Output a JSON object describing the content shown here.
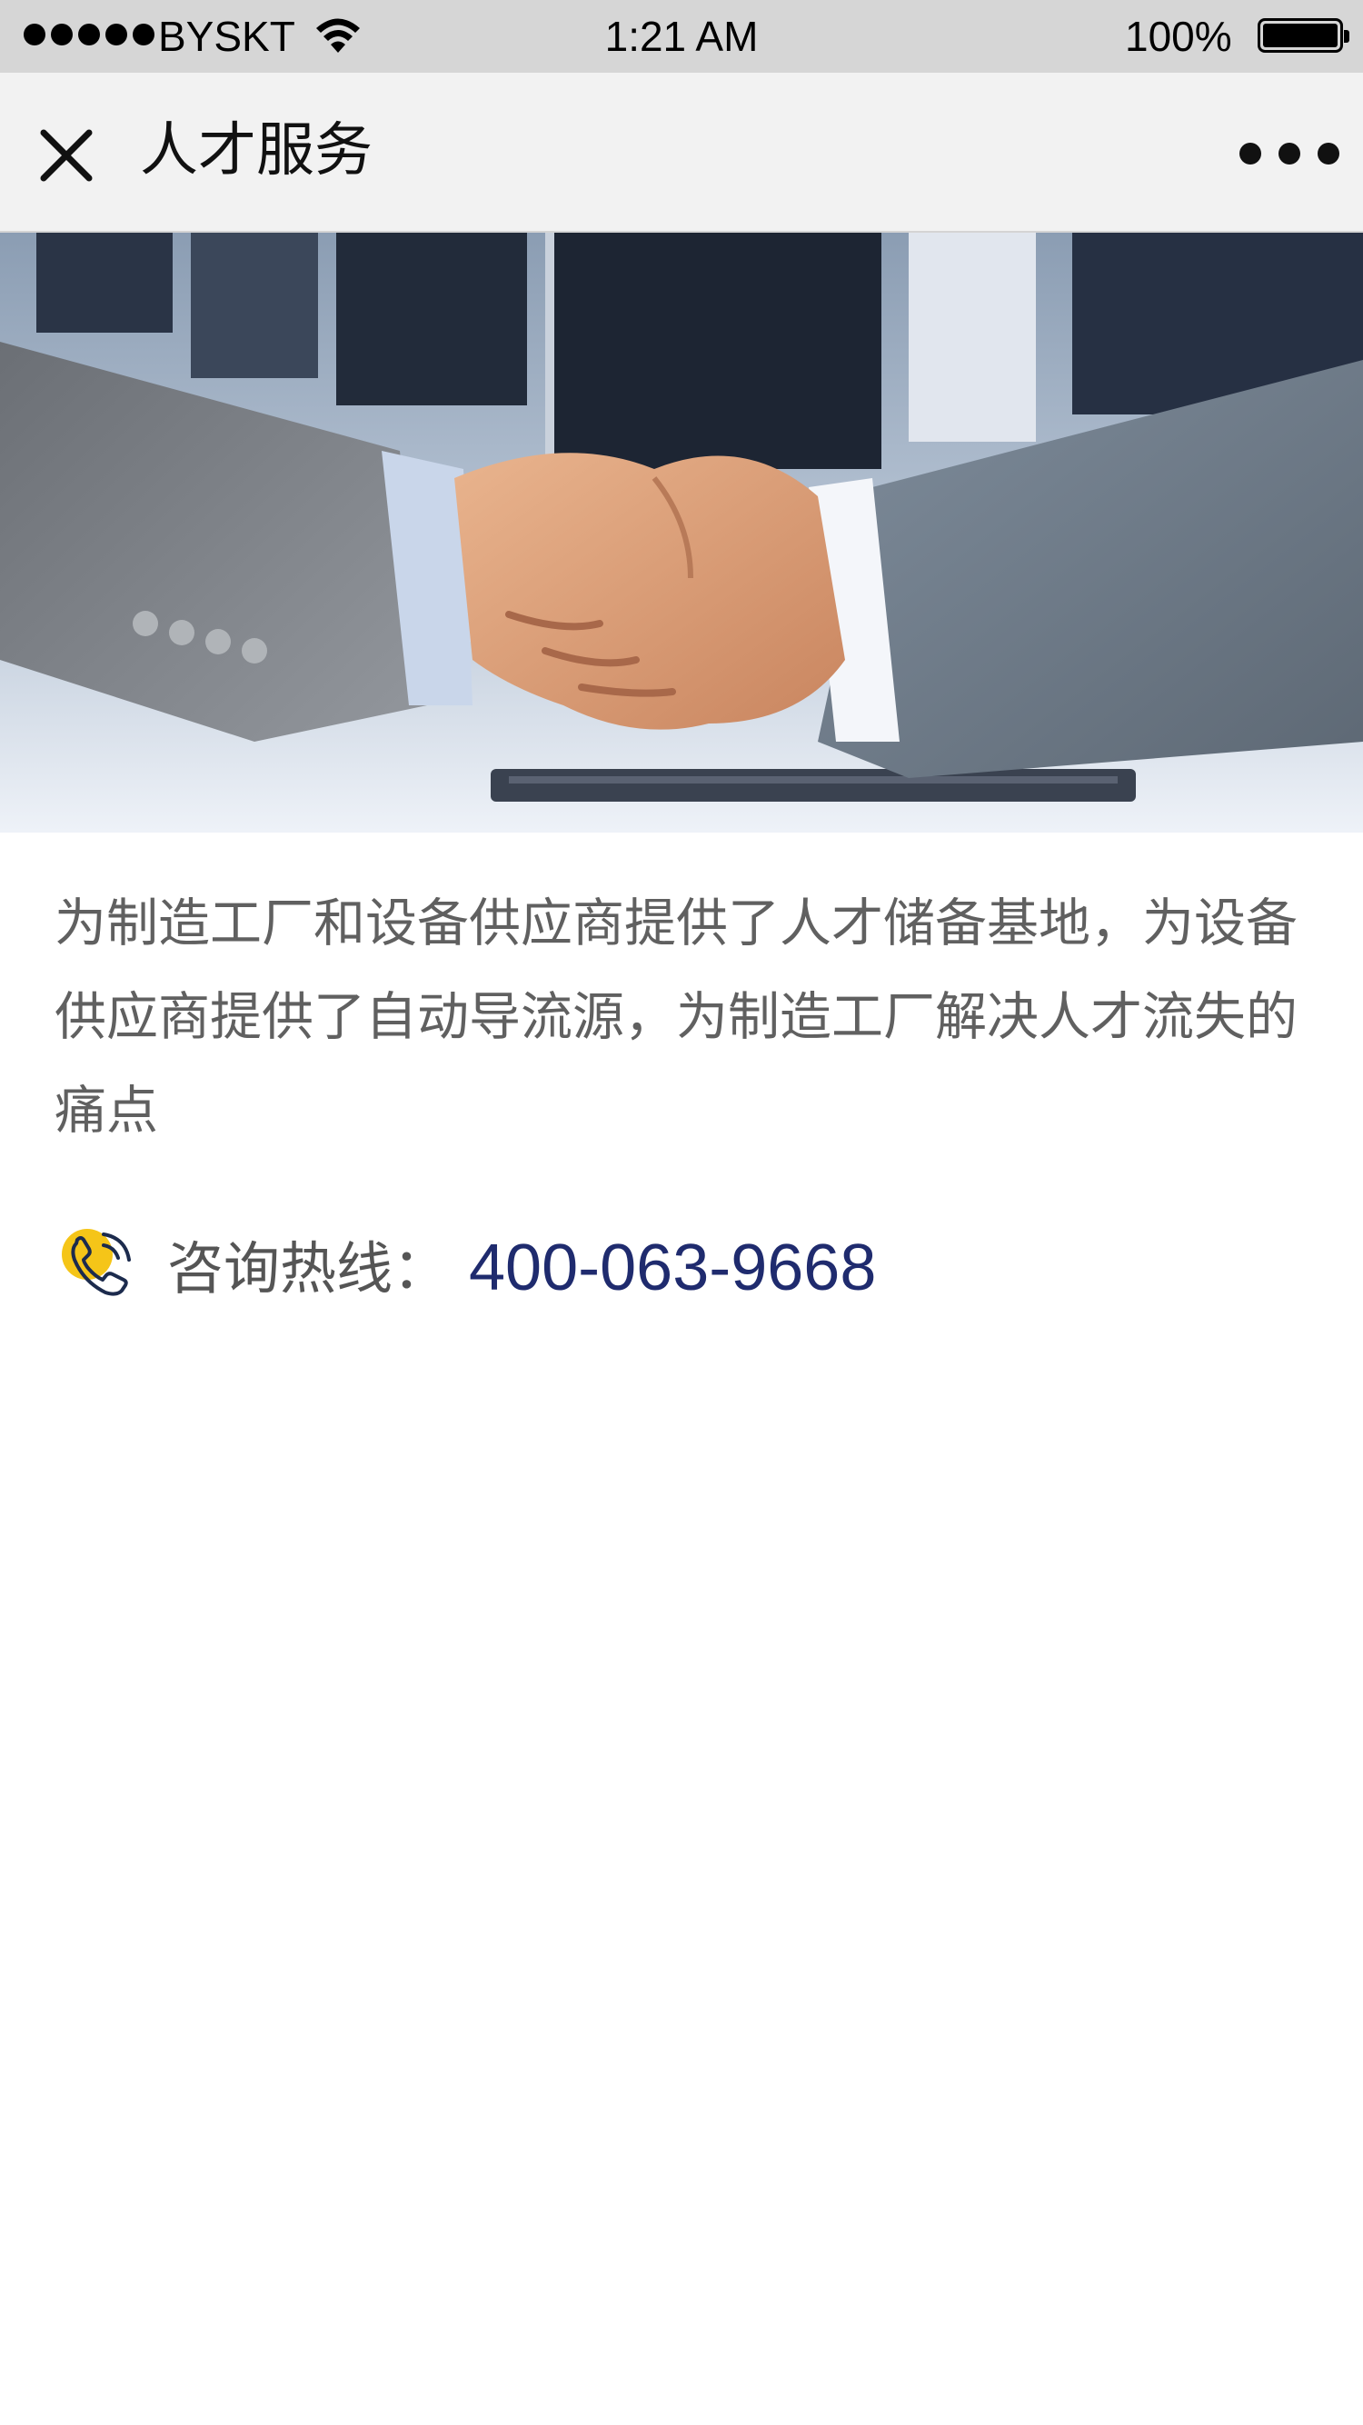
{
  "status_bar": {
    "carrier": "BYSKT",
    "time": "1:21 AM",
    "battery": "100%"
  },
  "nav": {
    "title": "人才服务",
    "close_icon": "close-icon",
    "more_icon": "more-icon"
  },
  "banner": {
    "image": "handshake-photo"
  },
  "content": {
    "description": "为制造工厂和设备供应商提供了人才储备基地，为设备供应商提供了自动导流源，为制造工厂解决人才流失的痛点"
  },
  "hotline": {
    "label": "咨询热线：",
    "number": "400-063-9668",
    "icon": "phone-icon",
    "number_color": "#1f2b6e",
    "icon_color": "#f5c518"
  }
}
